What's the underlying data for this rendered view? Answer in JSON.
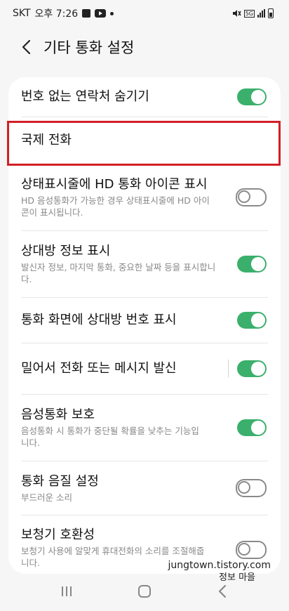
{
  "status_bar": {
    "carrier": "SKT",
    "time": "오후 7:26",
    "network": "5G"
  },
  "header": {
    "title": "기타 통화 설정"
  },
  "settings": [
    {
      "title": "번호 없는 연락처 숨기기",
      "subtitle": "",
      "toggle": "on"
    },
    {
      "title": "국제 전화",
      "subtitle": "",
      "toggle": "none"
    },
    {
      "title": "상태표시줄에 HD 통화 아이콘 표시",
      "subtitle": "HD 음성통화가 가능한 경우 상태표시줄에 HD 아이콘이 표시됩니다.",
      "toggle": "off"
    },
    {
      "title": "상대방 정보 표시",
      "subtitle": "발신자 정보, 마지막 통화, 중요한 날짜 등을 표시합니다.",
      "toggle": "on"
    },
    {
      "title": "통화 화면에 상대방 번호 표시",
      "subtitle": "",
      "toggle": "on"
    },
    {
      "title": "밀어서 전화 또는 메시지 발신",
      "subtitle": "",
      "toggle": "on"
    },
    {
      "title": "음성통화 보호",
      "subtitle": "음성통화 시 통화가 중단될 확률을 낮추는 기능입니다.",
      "toggle": "on"
    },
    {
      "title": "통화 음질 설정",
      "subtitle": "부드러운 소리",
      "toggle": "off"
    },
    {
      "title": "보청기 호환성",
      "subtitle": "보청기 사용에 알맞게 휴대전화의 소리를 조절해줍니다.",
      "toggle": "off"
    }
  ],
  "watermark": {
    "line1": "jungtown.tistory.com",
    "line2": "정보 마을"
  },
  "colors": {
    "toggle_on": "#3bb06c",
    "highlight": "#d21f26"
  }
}
